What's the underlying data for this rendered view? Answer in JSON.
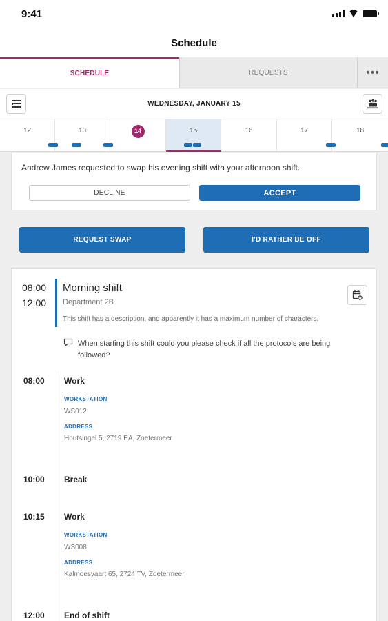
{
  "status_bar": {
    "time": "9:41"
  },
  "header": {
    "title": "Schedule"
  },
  "tabs": [
    {
      "label": "SCHEDULE",
      "active": true
    },
    {
      "label": "REQUESTS",
      "active": false
    }
  ],
  "more_label": "•••",
  "date_bar": {
    "title": "WEDNESDAY, JANUARY 15"
  },
  "week_days": [
    {
      "day": "12",
      "shift_count": 1
    },
    {
      "day": "13",
      "shift_count": 1
    },
    {
      "day": "14",
      "today": true,
      "shift_count": 1
    },
    {
      "day": "15",
      "selected": true,
      "shift_count": 2
    },
    {
      "day": "16",
      "shift_count": 0
    },
    {
      "day": "17",
      "shift_count": 0
    },
    {
      "day": "18",
      "shift_count": 1
    }
  ],
  "swap_request": {
    "message": "Andrew James requested to swap his evening shift with your afternoon shift.",
    "decline_label": "DECLINE",
    "accept_label": "ACCEPT"
  },
  "actions": {
    "request_swap_label": "REQUEST SWAP",
    "rather_off_label": "I'D RATHER BE OFF"
  },
  "shift": {
    "start": "08:00",
    "end": "12:00",
    "name": "Morning shift",
    "department": "Department 2B",
    "description": "This shift has a description, and apparently it has a maximum number of characters.",
    "note": "When starting this shift could you please check if all the protocols are being followed?"
  },
  "timeline": [
    {
      "time": "08:00",
      "title": "Work",
      "workstation_label": "WORKSTATION",
      "workstation": "WS012",
      "address_label": "ADDRESS",
      "address": "Houtsingel 5, 2719 EA, Zoetermeer"
    },
    {
      "time": "10:00",
      "title": "Break"
    },
    {
      "time": "10:15",
      "title": "Work",
      "workstation_label": "WORKSTATION",
      "workstation": "WS008",
      "address_label": "ADDRESS",
      "address": "Kalmoesvaart 65, 2724 TV, Zoetermeer"
    },
    {
      "time": "12:00",
      "title": "End of shift"
    }
  ],
  "colors": {
    "accent": "#a4286e",
    "primary": "#1f6db5",
    "background": "#eeeeee"
  },
  "icons": {
    "list": "list-icon",
    "people": "people-icon",
    "calendar_settings": "calendar-settings-icon",
    "comment": "comment-icon"
  }
}
